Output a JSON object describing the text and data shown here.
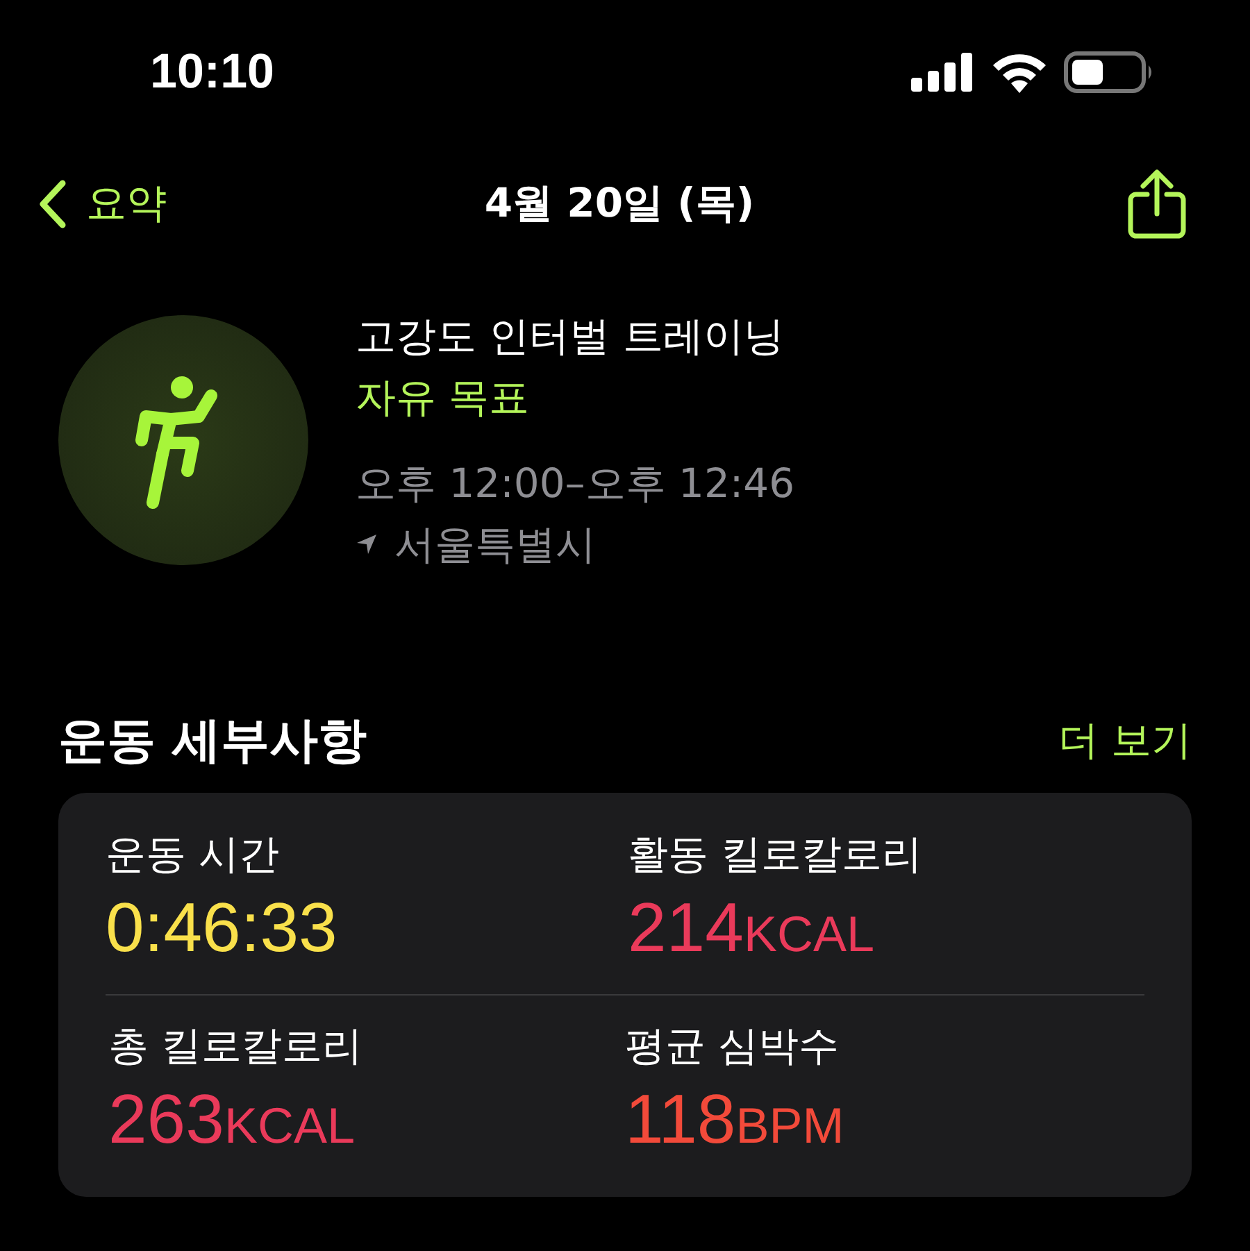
{
  "status_bar": {
    "time": "10:10"
  },
  "nav": {
    "back_label": "요약",
    "title": "4월 20일 (목)"
  },
  "workout": {
    "name": "고강도 인터벌 트레이닝",
    "goal": "자유 목표",
    "time_range": "오후 12:00–오후 12:46",
    "location": "서울특별시"
  },
  "details": {
    "title": "운동 세부사항",
    "more_link": "더 보기",
    "metrics": [
      {
        "label": "운동 시간",
        "value": "0:46:33",
        "color": "#f9e04b"
      },
      {
        "label": "활동 킬로칼로리",
        "value": "214",
        "unit": "KCAL",
        "color": "#ea3a5a"
      },
      {
        "label": "총 킬로칼로리",
        "value": "263",
        "unit": "KCAL",
        "color": "#ea3a5a"
      },
      {
        "label": "평균 심박수",
        "value": "118",
        "unit": "BPM",
        "color": "#f24a3a"
      }
    ]
  }
}
